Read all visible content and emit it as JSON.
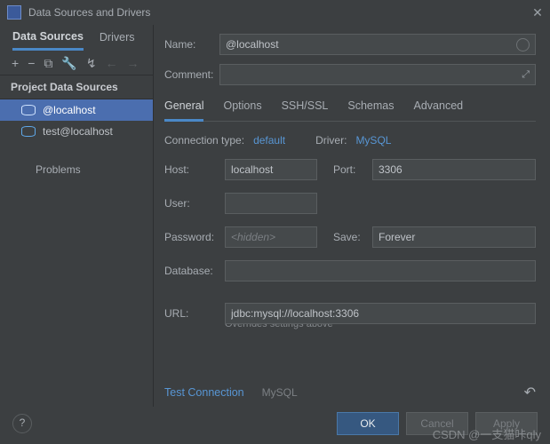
{
  "window": {
    "title": "Data Sources and Drivers"
  },
  "source_tabs": {
    "data_sources": "Data Sources",
    "drivers": "Drivers"
  },
  "toolbar_icons": {
    "add": "+",
    "remove": "−",
    "copy": "⧉",
    "wrench": "🔧",
    "reset": "↯",
    "back": "←",
    "fwd": "→"
  },
  "tree": {
    "header": "Project Data Sources",
    "items": [
      {
        "label": "@localhost",
        "selected": true
      },
      {
        "label": "test@localhost",
        "selected": false
      }
    ],
    "problems": "Problems"
  },
  "form": {
    "name_label": "Name:",
    "name_value": "@localhost",
    "comment_label": "Comment:",
    "comment_value": ""
  },
  "detail_tabs": {
    "general": "General",
    "options": "Options",
    "sshssl": "SSH/SSL",
    "schemas": "Schemas",
    "advanced": "Advanced"
  },
  "connection": {
    "type_label": "Connection type:",
    "type_value": "default",
    "driver_label": "Driver:",
    "driver_value": "MySQL"
  },
  "fields": {
    "host_label": "Host:",
    "host_value": "localhost",
    "port_label": "Port:",
    "port_value": "3306",
    "user_label": "User:",
    "user_value": "",
    "password_label": "Password:",
    "password_placeholder": "<hidden>",
    "save_label": "Save:",
    "save_value": "Forever",
    "database_label": "Database:",
    "database_value": "",
    "url_label": "URL:",
    "url_value": "jdbc:mysql://localhost:3306",
    "url_hint": "Overrides settings above"
  },
  "footer_links": {
    "test": "Test Connection",
    "driver": "MySQL"
  },
  "buttons": {
    "ok": "OK",
    "cancel": "Cancel",
    "apply": "Apply"
  },
  "watermark": "CSDN @一支猫咔qly"
}
